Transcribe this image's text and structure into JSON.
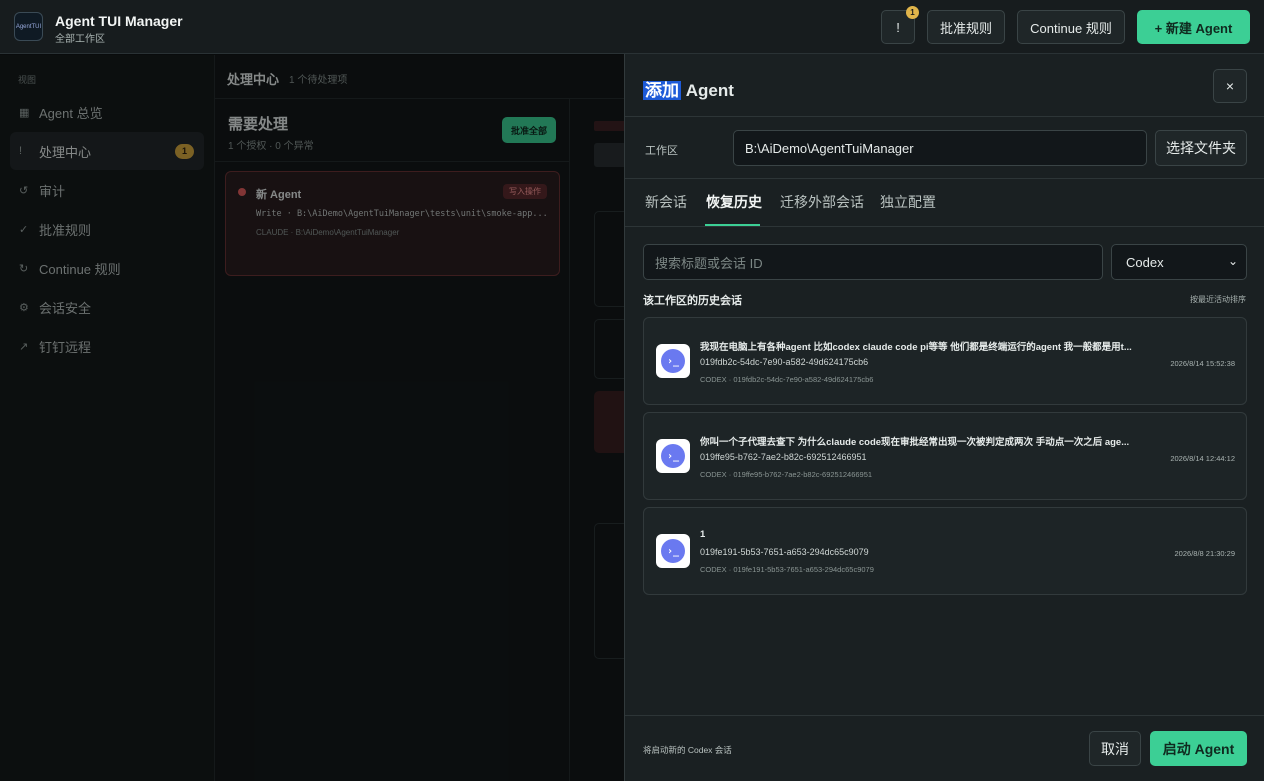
{
  "app": {
    "title": "Agent TUI Manager",
    "subtitle": "全部工作区",
    "logo_text": "AgentTUI"
  },
  "toolbar": {
    "alert_label": "!",
    "alert_count": "1",
    "approve_rules": "批准规则",
    "continue_rules": "Continue 规则",
    "new_agent": "+ 新建 Agent"
  },
  "sidebar": {
    "section_label": "视图",
    "items": [
      {
        "icon": "▦",
        "label": "Agent 总览"
      },
      {
        "icon": "!",
        "label": "处理中心",
        "count": "1"
      },
      {
        "icon": "↺",
        "label": "审计"
      },
      {
        "icon": "✓",
        "label": "批准规则"
      },
      {
        "icon": "↻",
        "label": "Continue 规则"
      },
      {
        "icon": "⚙",
        "label": "会话安全"
      },
      {
        "icon": "↗",
        "label": "钉钉远程"
      }
    ]
  },
  "main": {
    "title": "处理中心",
    "pending": "1 个待处理项",
    "needs_title": "需要处理",
    "needs_sub": "1 个授权 · 0 个异常",
    "approve_all": "批准全部",
    "card": {
      "name": "新 Agent",
      "tag": "写入操作",
      "command": "Write · B:\\AiDemo\\AgentTuiManager\\tests\\unit\\smoke-app...",
      "meta": "CLAUDE · B:\\AiDemo\\AgentTuiManager"
    }
  },
  "dialog": {
    "title_highlight": "添加",
    "title_rest": " Agent",
    "close": "×",
    "workspace_label": "工作区",
    "workspace_value": "B:\\AiDemo\\AgentTuiManager",
    "choose_folder": "选择文件夹",
    "tabs": [
      "新会话",
      "恢复历史",
      "迁移外部会话",
      "独立配置"
    ],
    "search_placeholder": "搜索标题或会话 ID",
    "provider_selected": "Codex",
    "history_title": "该工作区的历史会话",
    "history_sort": "按最近活动排序",
    "history": [
      {
        "title": "我现在电脑上有各种agent 比如codex claude code pi等等 他们都是终端运行的agent 我一般都是用t...",
        "id": "019fdb2c-54dc-7e90-a582-49d624175cb6",
        "meta": "CODEX · 019fdb2c-54dc-7e90-a582-49d624175cb6",
        "time": "2026/8/14 15:52:38"
      },
      {
        "title": "你叫一个子代理去查下 为什么claude code现在审批经常出现一次被判定成两次 手动点一次之后 age...",
        "id": "019ffe95-b762-7ae2-b82c-692512466951",
        "meta": "CODEX · 019ffe95-b762-7ae2-b82c-692512466951",
        "time": "2026/8/14 12:44:12"
      },
      {
        "title": "1",
        "id": "019fe191-5b53-7651-a653-294dc65c9079",
        "meta": "CODEX · 019fe191-5b53-7651-a653-294dc65c9079",
        "time": "2026/8/8 21:30:29"
      }
    ],
    "footer_note": "将启动新的 Codex 会话",
    "cancel": "取消",
    "start": "启动 Agent"
  }
}
